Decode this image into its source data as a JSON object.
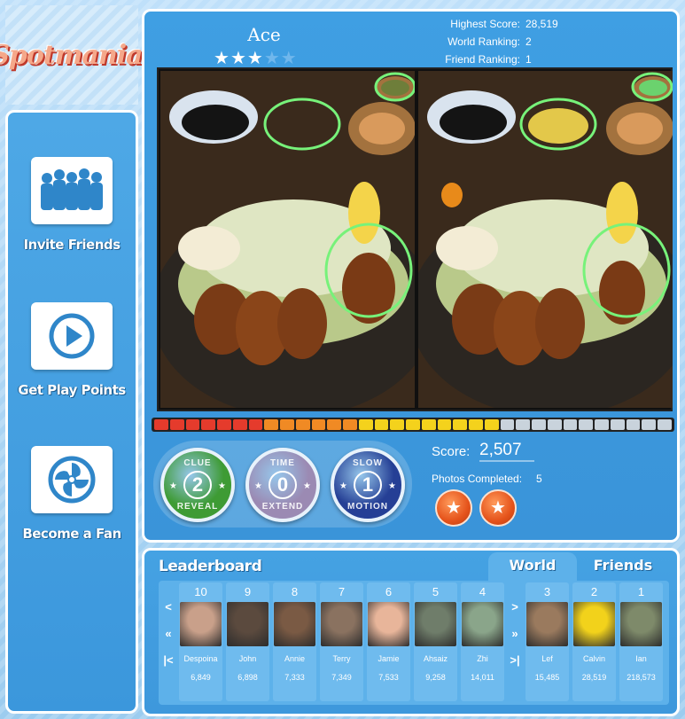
{
  "app": {
    "logo": "Spotmania!"
  },
  "sidebar": {
    "items": [
      {
        "label": "Invite Friends",
        "icon": "people-silhouette-icon"
      },
      {
        "label": "Get Play Points",
        "icon": "play-icon"
      },
      {
        "label": "Become a Fan",
        "icon": "fan-icon"
      }
    ]
  },
  "player": {
    "name": "Ace",
    "stars_filled": 3,
    "stars_total": 5
  },
  "stats": {
    "highest_score_label": "Highest Score:",
    "highest_score": "28,519",
    "world_ranking_label": "World Ranking:",
    "world_ranking": "2",
    "friend_ranking_label": "Friend Ranking:",
    "friend_ranking": "1"
  },
  "timer": {
    "segments_total": 33,
    "segments_filled": 22,
    "colors": {
      "red": "#e53b2c",
      "orange": "#f08a24",
      "yellow": "#f4d21c",
      "empty": "#c9d3dc"
    }
  },
  "powerups": [
    {
      "top": "CLUE",
      "bottom": "REVEAL",
      "count": "2",
      "color": "#3e9b34"
    },
    {
      "top": "TIME",
      "bottom": "EXTEND",
      "count": "0",
      "color": "#9b8ab3"
    },
    {
      "top": "SLOW",
      "bottom": "MOTION",
      "count": "1",
      "color": "#253f95"
    }
  ],
  "score": {
    "label": "Score:",
    "value": "2,507",
    "photos_label": "Photos Completed:",
    "photos_value": "5",
    "medals": 2
  },
  "leaderboard": {
    "title": "Leaderboard",
    "tabs": {
      "world": "World",
      "friends": "Friends"
    },
    "nav_left": [
      "<",
      "«",
      "|<"
    ],
    "nav_right": [
      ">",
      "»",
      ">|"
    ],
    "players": [
      {
        "rank": "10",
        "name": "Despoina",
        "score": "6,849",
        "color": "#c9a08a"
      },
      {
        "rank": "9",
        "name": "John",
        "score": "6,898",
        "color": "#5b4a3e"
      },
      {
        "rank": "8",
        "name": "Annie",
        "score": "7,333",
        "color": "#7a5a44"
      },
      {
        "rank": "7",
        "name": "Terry",
        "score": "7,349",
        "color": "#8a7260"
      },
      {
        "rank": "6",
        "name": "Jamie",
        "score": "7,533",
        "color": "#e8b59a"
      },
      {
        "rank": "5",
        "name": "Ahsaiz",
        "score": "9,258",
        "color": "#6f7d6a"
      },
      {
        "rank": "4",
        "name": "Zhi",
        "score": "14,011",
        "color": "#8aa58a"
      },
      {
        "rank": "3",
        "name": "Lef",
        "score": "15,485",
        "color": "#9a7a5e"
      },
      {
        "rank": "2",
        "name": "Calvin",
        "score": "28,519",
        "color": "#f2d21b"
      },
      {
        "rank": "1",
        "name": "Ian",
        "score": "218,573",
        "color": "#7e8a6a"
      }
    ]
  }
}
